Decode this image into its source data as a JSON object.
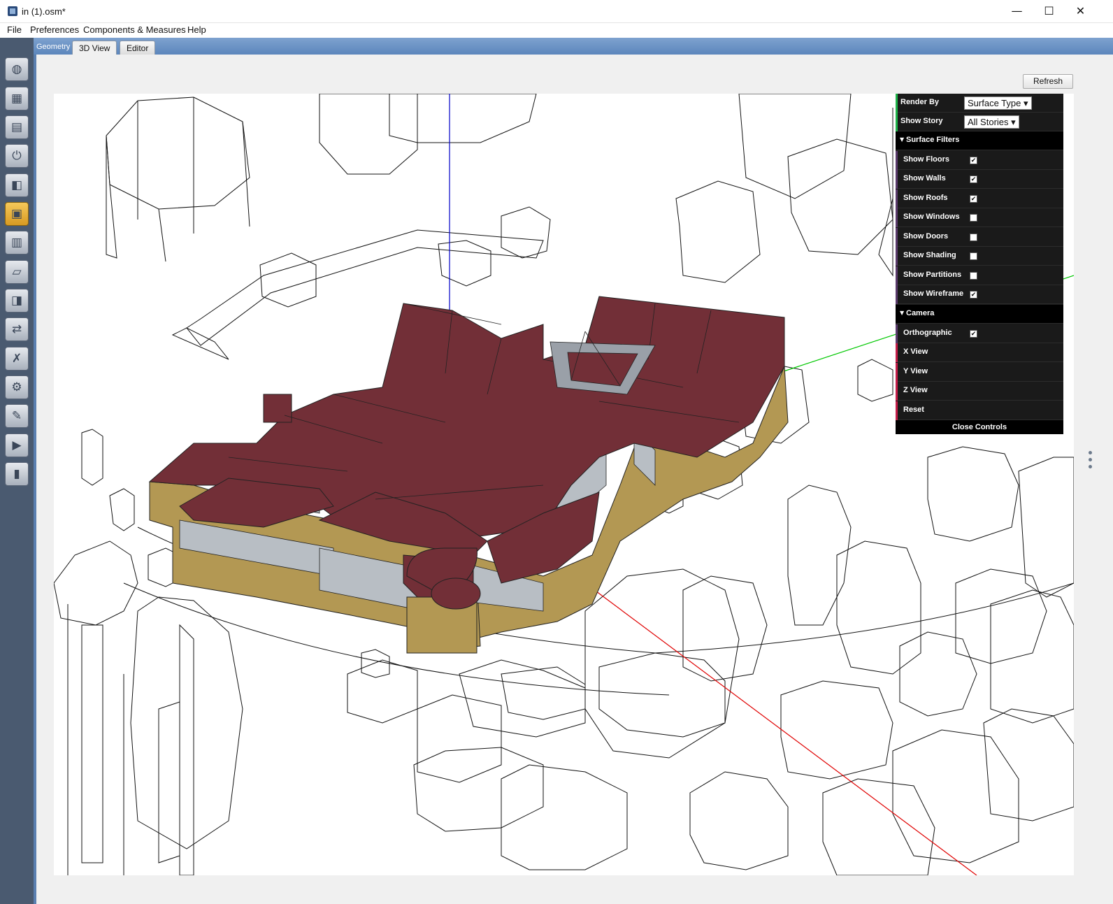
{
  "window": {
    "title": "in (1).osm*",
    "minimize": "—",
    "maximize": "☐",
    "close": "✕"
  },
  "menu": [
    "File",
    "Preferences",
    "Components & Measures",
    "Help"
  ],
  "toolbar_icons": [
    "site-icon",
    "schedules-icon",
    "constructions-icon",
    "loads-icon",
    "space-types-icon",
    "geometry-icon",
    "facility-icon",
    "spaces-icon",
    "thermal-zones-icon",
    "hvac-icon",
    "variables-icon",
    "simulation-settings-icon",
    "measures-icon",
    "run-icon",
    "results-icon"
  ],
  "tabs": {
    "section": "Geometry",
    "items": [
      "3D View",
      "Editor"
    ],
    "selected": "3D View"
  },
  "refresh_label": "Refresh",
  "controls": {
    "render_by_label": "Render By",
    "render_by_value": "Surface Type",
    "show_story_label": "Show Story",
    "show_story_value": "All Stories",
    "surface_filters_title": "Surface Filters",
    "filters": [
      {
        "label": "Show Floors",
        "checked": true
      },
      {
        "label": "Show Walls",
        "checked": true
      },
      {
        "label": "Show Roofs",
        "checked": true
      },
      {
        "label": "Show Windows",
        "checked": false
      },
      {
        "label": "Show Doors",
        "checked": false
      },
      {
        "label": "Show Shading",
        "checked": false
      },
      {
        "label": "Show Partitions",
        "checked": false
      },
      {
        "label": "Show Wireframe",
        "checked": true
      }
    ],
    "camera_title": "Camera",
    "orthographic_label": "Orthographic",
    "orthographic_checked": true,
    "camera_buttons": [
      "X View",
      "Y View",
      "Z View",
      "Reset"
    ],
    "close_label": "Close Controls"
  },
  "colors": {
    "roof": "#722f37",
    "wall": "#b39853",
    "window": "#b8bec4",
    "axis_x": "#e00000",
    "axis_y": "#00c800",
    "axis_z": "#0000c8",
    "panel_bg": "#1a1a1a",
    "accent_green": "#1fb34a",
    "accent_purple": "#5a3b6b",
    "accent_red": "#c41e4a"
  }
}
